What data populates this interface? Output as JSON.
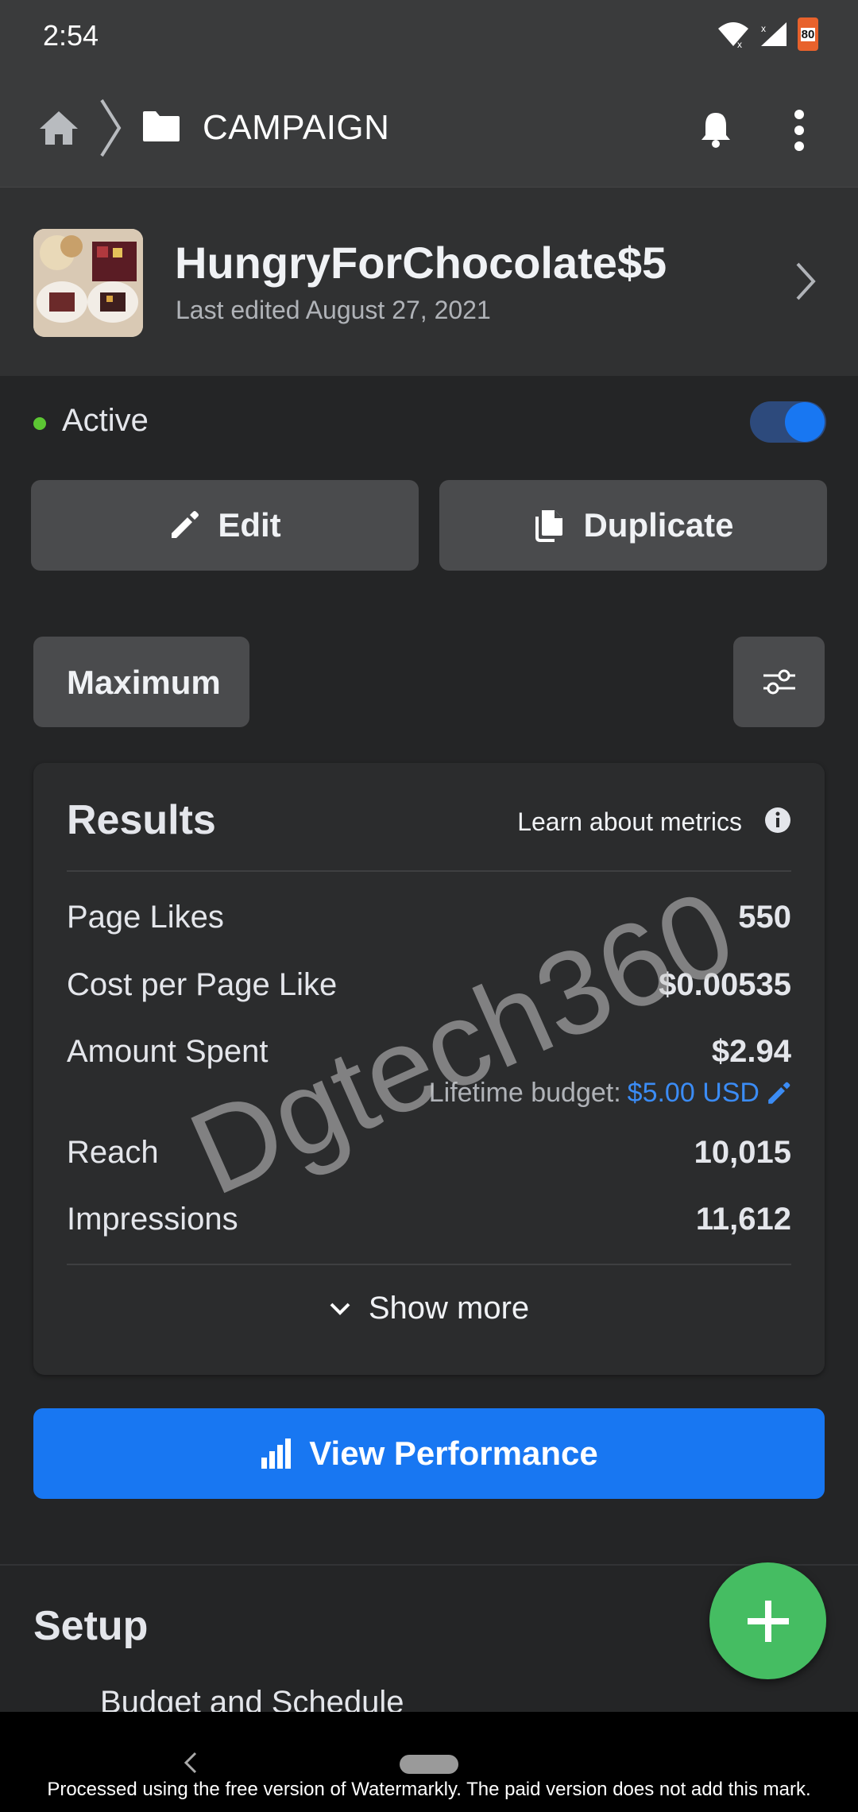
{
  "status_bar": {
    "time": "2:54",
    "battery": "80"
  },
  "app_bar": {
    "breadcrumb": "CAMPAIGN"
  },
  "campaign": {
    "name": "HungryForChocolate$5",
    "last_edited": "Last edited August 27, 2021"
  },
  "status": {
    "label": "Active",
    "enabled": true
  },
  "actions": {
    "edit_label": "Edit",
    "duplicate_label": "Duplicate"
  },
  "date_range": {
    "label": "Maximum"
  },
  "results": {
    "title": "Results",
    "learn_label": "Learn about metrics",
    "rows": [
      {
        "label": "Page Likes",
        "value": "550"
      },
      {
        "label": "Cost per Page Like",
        "value": "$0.00535"
      },
      {
        "label": "Amount Spent",
        "value": "$2.94"
      },
      {
        "label": "Reach",
        "value": "10,015"
      },
      {
        "label": "Impressions",
        "value": "11,612"
      }
    ],
    "budget_label": "Lifetime budget:",
    "budget_amount": "$5.00 USD",
    "show_more": "Show more"
  },
  "performance_button": "View Performance",
  "setup": {
    "title": "Setup",
    "first_item": "Budget and Schedule"
  },
  "watermark_text": "Dgtech360",
  "footer_notice": "Processed using the free version of Watermarkly. The paid version does not add this mark.",
  "colors": {
    "accent": "#1877f2",
    "active_dot": "#5cc733",
    "fab": "#45bd62",
    "link": "#3b8cf5"
  }
}
